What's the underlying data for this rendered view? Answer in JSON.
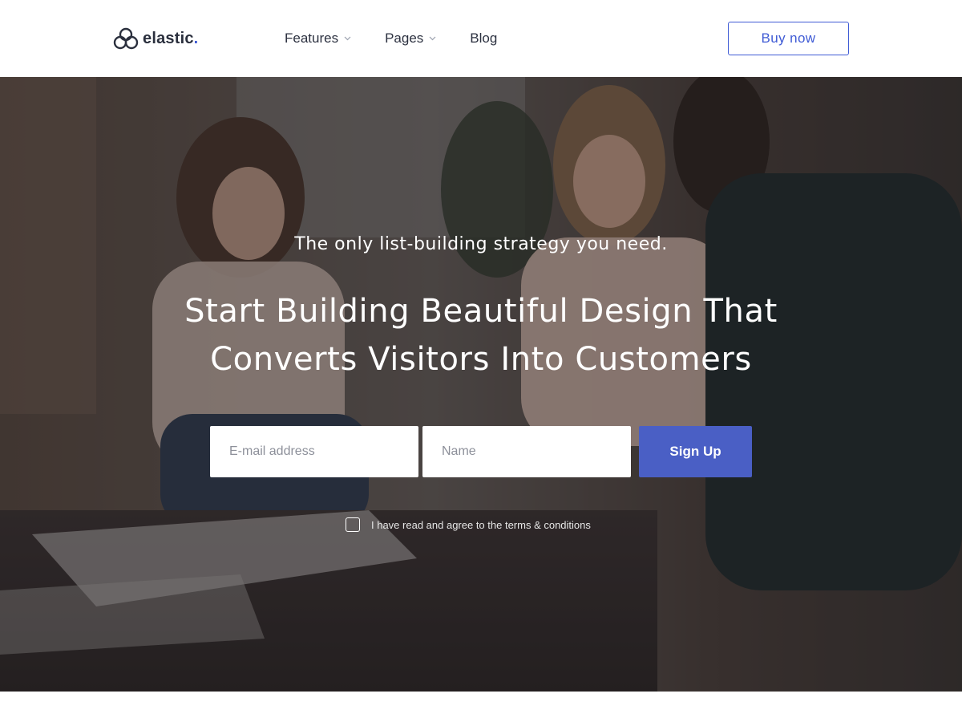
{
  "brand": {
    "name": "elastic",
    "dot": ".",
    "logo_icon": "triple-ring-logo-icon",
    "accent_color": "#3f5bd5"
  },
  "nav": {
    "items": [
      {
        "label": "Features",
        "has_dropdown": true
      },
      {
        "label": "Pages",
        "has_dropdown": true
      },
      {
        "label": "Blog",
        "has_dropdown": false
      }
    ]
  },
  "header": {
    "buy_label": "Buy now"
  },
  "hero": {
    "subtitle": "The only list-building strategy you need.",
    "title_line1": "Start Building Beautiful Design That",
    "title_line2": "Converts Visitors Into Customers",
    "email_placeholder": "E-mail address",
    "name_placeholder": "Name",
    "signup_label": "Sign Up",
    "signup_color": "#4a5fc5",
    "terms_label": "I have read and agree to the terms & conditions",
    "terms_checked": false
  }
}
